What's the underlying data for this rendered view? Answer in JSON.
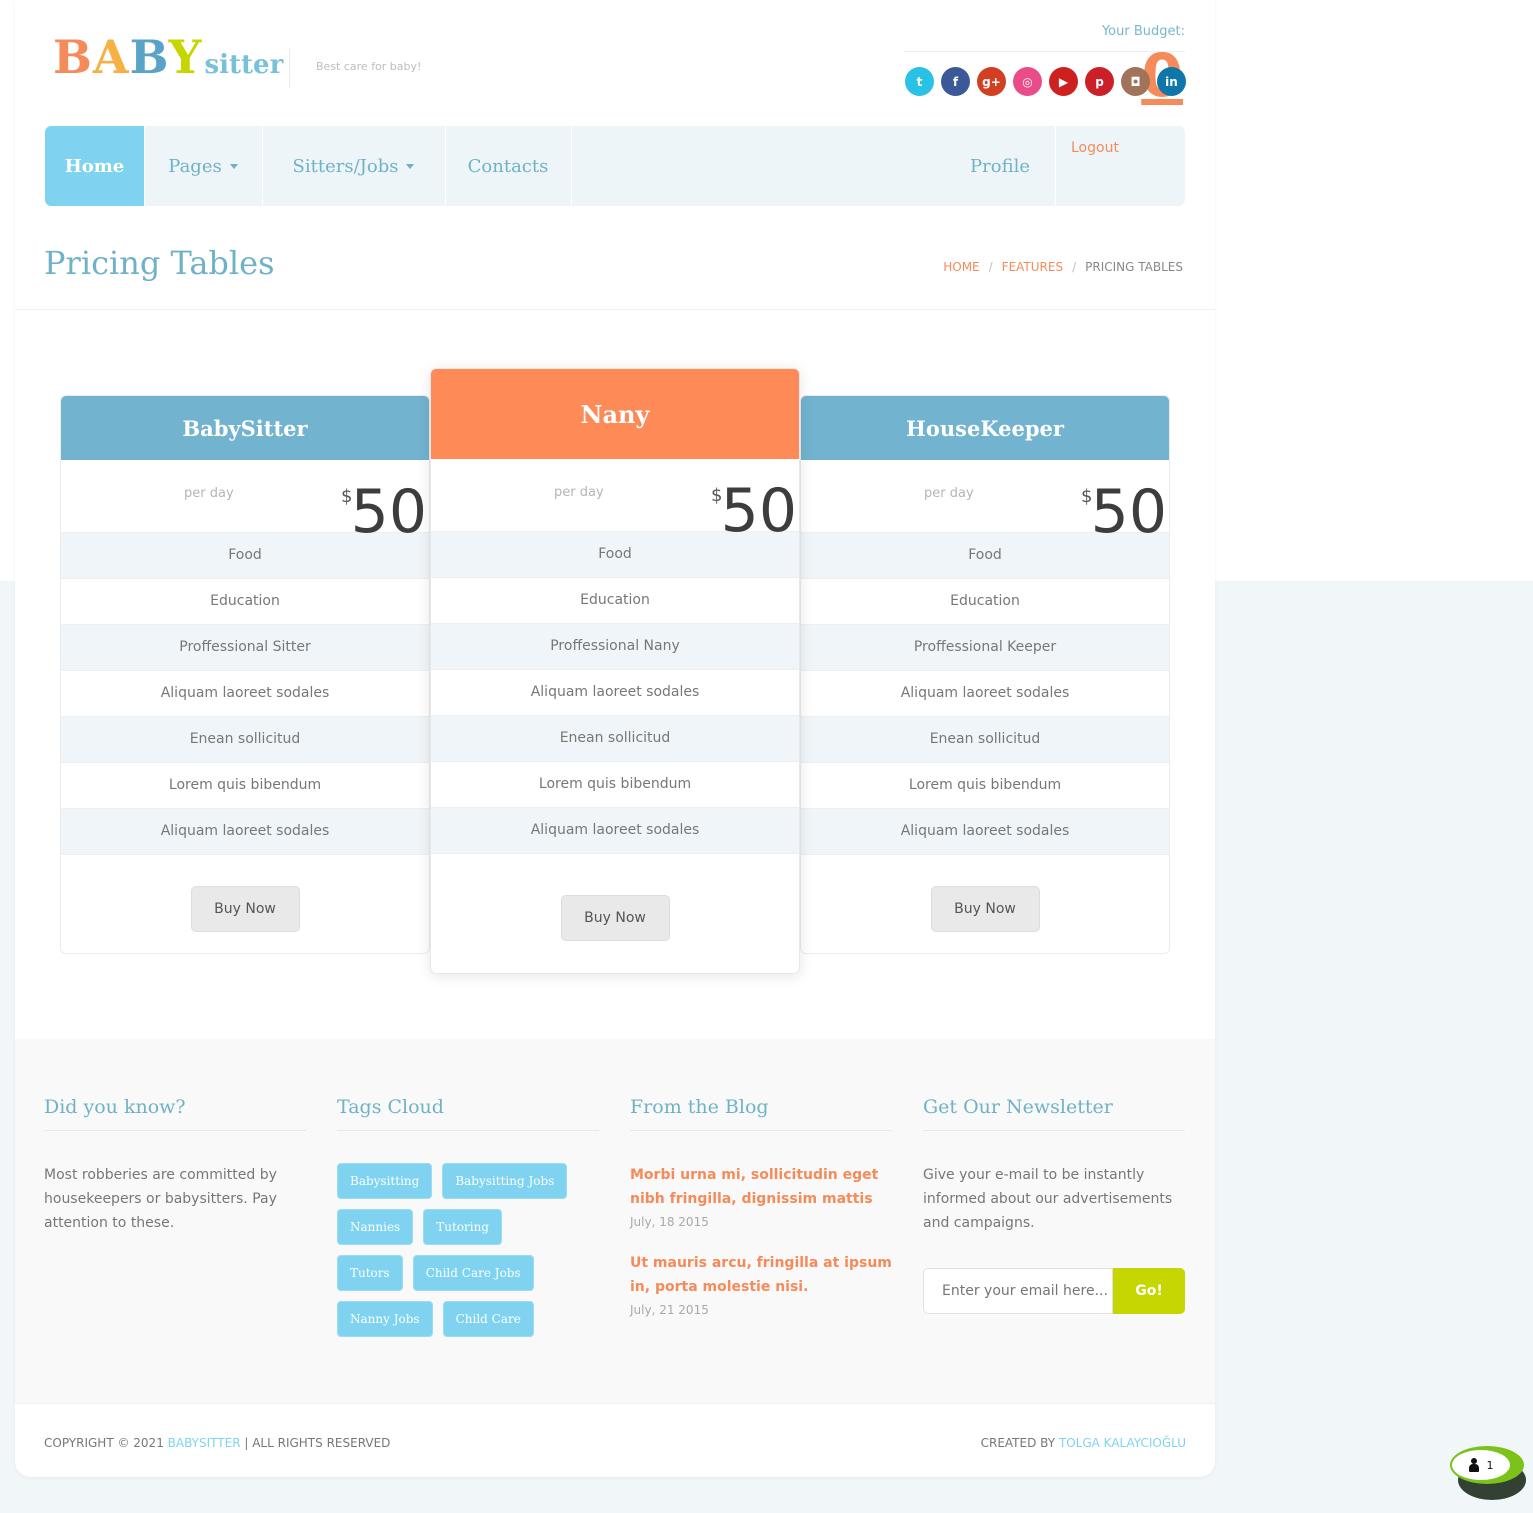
{
  "brand": {
    "logo_letters": [
      {
        "char": "B",
        "color": "#f58b5a"
      },
      {
        "char": "A",
        "color": "#f5b144"
      },
      {
        "char": "B",
        "color": "#5aa3c8"
      },
      {
        "char": "Y",
        "color": "#c6d600"
      }
    ],
    "logo_suffix": "sitter",
    "tagline": "Best care for baby!"
  },
  "budget": {
    "label": "Your Budget:",
    "value": "0"
  },
  "social": [
    {
      "icon": "twitter-icon",
      "glyph": "t",
      "color": "#29c1e6"
    },
    {
      "icon": "facebook-icon",
      "glyph": "f",
      "color": "#3b5998"
    },
    {
      "icon": "google-plus-icon",
      "glyph": "g+",
      "color": "#d23f22"
    },
    {
      "icon": "dribbble-icon",
      "glyph": "◎",
      "color": "#ea4c89"
    },
    {
      "icon": "youtube-icon",
      "glyph": "▶",
      "color": "#cd201f"
    },
    {
      "icon": "pinterest-icon",
      "glyph": "p",
      "color": "#cb2027"
    },
    {
      "icon": "instagram-icon",
      "glyph": "◘",
      "color": "#a0735a"
    },
    {
      "icon": "linkedin-icon",
      "glyph": "in",
      "color": "#0e76a8"
    }
  ],
  "nav": {
    "items": [
      {
        "label": "Home",
        "active": true,
        "dropdown": false
      },
      {
        "label": "Pages",
        "active": false,
        "dropdown": true
      },
      {
        "label": "Sitters/Jobs",
        "active": false,
        "dropdown": true
      },
      {
        "label": "Contacts",
        "active": false,
        "dropdown": false
      }
    ],
    "profile": "Profile",
    "logout": "Logout"
  },
  "page_title": "Pricing Tables",
  "breadcrumb": [
    "HOME",
    "FEATURES",
    "PRICING TABLES"
  ],
  "plans": [
    {
      "name": "BabySitter",
      "period": "per day",
      "currency": "$",
      "price": "50",
      "featured": false,
      "features": [
        "Food",
        "Education",
        "Proffessional Sitter",
        "Aliquam laoreet sodales",
        "Enean sollicitud",
        "Lorem quis bibendum",
        "Aliquam laoreet sodales"
      ],
      "button": "Buy Now"
    },
    {
      "name": "Nany",
      "period": "per day",
      "currency": "$",
      "price": "50",
      "featured": true,
      "features": [
        "Food",
        "Education",
        "Proffessional Nany",
        "Aliquam laoreet sodales",
        "Enean sollicitud",
        "Lorem quis bibendum",
        "Aliquam laoreet sodales"
      ],
      "button": "Buy Now"
    },
    {
      "name": "HouseKeeper",
      "period": "per day",
      "currency": "$",
      "price": "50",
      "featured": false,
      "features": [
        "Food",
        "Education",
        "Proffessional Keeper",
        "Aliquam laoreet sodales",
        "Enean sollicitud",
        "Lorem quis bibendum",
        "Aliquam laoreet sodales"
      ],
      "button": "Buy Now"
    }
  ],
  "footer": {
    "did_you_know": {
      "heading": "Did you know?",
      "text": "Most robberies are committed by housekeepers or babysitters. Pay attention to these."
    },
    "tags": {
      "heading": "Tags Cloud",
      "items": [
        "Babysitting",
        "Babysitting Jobs",
        "Nannies",
        "Tutoring",
        "Tutors",
        "Child Care Jobs",
        "Nanny Jobs",
        "Child Care"
      ]
    },
    "blog": {
      "heading": "From the Blog",
      "posts": [
        {
          "title": "Morbi urna mi, sollicitudin eget nibh fringilla, dignissim mattis",
          "date": "July, 18 2015"
        },
        {
          "title": "Ut mauris arcu, fringilla at ipsum in, porta molestie nisi.",
          "date": "July, 21 2015"
        }
      ]
    },
    "newsletter": {
      "heading": "Get Our Newsletter",
      "text": "Give your e-mail to be instantly informed about our advertisements and campaigns.",
      "placeholder": "Enter your email here...",
      "button": "Go!"
    }
  },
  "copyright": {
    "prefix": "COPYRIGHT © 2021",
    "brand": "BABYSITTER",
    "suffix": "|  ALL RIGHTS RESERVED",
    "created_label": "CREATED BY",
    "author": "TOLGA KALAYCIOĞLU"
  },
  "chat_widget": {
    "count": "1"
  }
}
